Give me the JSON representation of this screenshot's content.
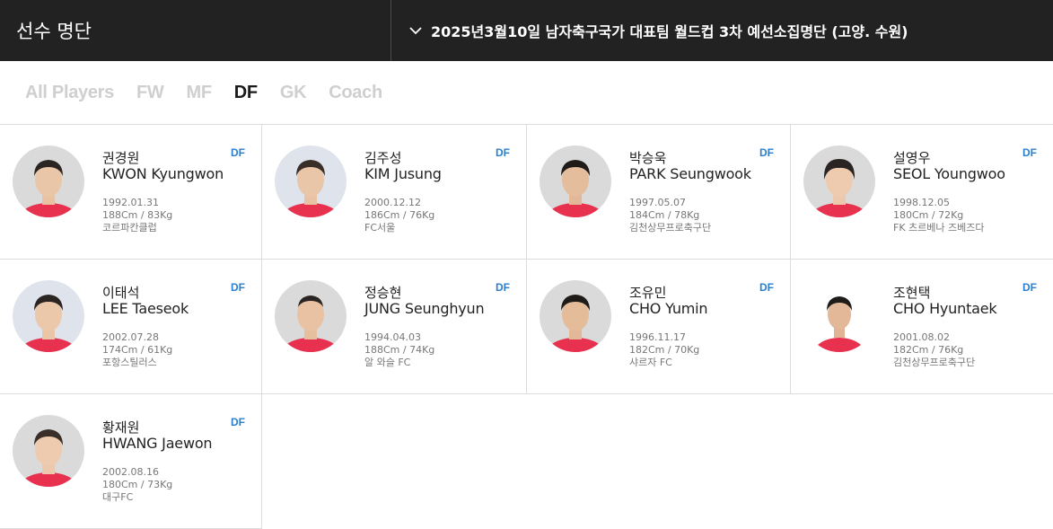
{
  "header": {
    "title": "선수 명단",
    "selector_label": "2025년3월10일 남자축구국가 대표팀 월드컵 3차 예선소집명단 (고양. 수원)"
  },
  "tabs": [
    {
      "label": "All Players",
      "active": false
    },
    {
      "label": "FW",
      "active": false
    },
    {
      "label": "MF",
      "active": false
    },
    {
      "label": "DF",
      "active": true
    },
    {
      "label": "GK",
      "active": false
    },
    {
      "label": "Coach",
      "active": false
    }
  ],
  "players": [
    {
      "kor": "권경원",
      "eng": "KWON Kyungwon",
      "pos": "DF",
      "birth": "1992.01.31",
      "body": "188Cm / 83Kg",
      "club": "코르파칸클럽"
    },
    {
      "kor": "김주성",
      "eng": "KIM Jusung",
      "pos": "DF",
      "birth": "2000.12.12",
      "body": "186Cm / 76Kg",
      "club": "FC서울"
    },
    {
      "kor": "박승욱",
      "eng": "PARK Seungwook",
      "pos": "DF",
      "birth": "1997.05.07",
      "body": "184Cm / 78Kg",
      "club": "김천상무프로축구단"
    },
    {
      "kor": "설영우",
      "eng": "SEOL Youngwoo",
      "pos": "DF",
      "birth": "1998.12.05",
      "body": "180Cm / 72Kg",
      "club": "FK 츠르베나 즈베즈다"
    },
    {
      "kor": "이태석",
      "eng": "LEE Taeseok",
      "pos": "DF",
      "birth": "2002.07.28",
      "body": "174Cm / 61Kg",
      "club": "포항스틸러스"
    },
    {
      "kor": "정승현",
      "eng": "JUNG Seunghyun",
      "pos": "DF",
      "birth": "1994.04.03",
      "body": "188Cm / 74Kg",
      "club": "알 와슬 FC"
    },
    {
      "kor": "조유민",
      "eng": "CHO Yumin",
      "pos": "DF",
      "birth": "1996.11.17",
      "body": "182Cm / 70Kg",
      "club": "샤르자 FC"
    },
    {
      "kor": "조현택",
      "eng": "CHO Hyuntaek",
      "pos": "DF",
      "birth": "2001.08.02",
      "body": "182Cm / 76Kg",
      "club": "김천상무프로축구단"
    },
    {
      "kor": "황재원",
      "eng": "HWANG Jaewon",
      "pos": "DF",
      "birth": "2002.08.16",
      "body": "180Cm / 73Kg",
      "club": "대구FC"
    }
  ],
  "colors": {
    "header_bg": "#222222",
    "position_badge": "#2a7fcf",
    "jersey": "#e8304f",
    "active_tab": "#1a1a1a",
    "inactive_tab": "#cfcfcf"
  },
  "icons": {
    "selector": "chevron-down-icon",
    "photo": "player-photo"
  }
}
